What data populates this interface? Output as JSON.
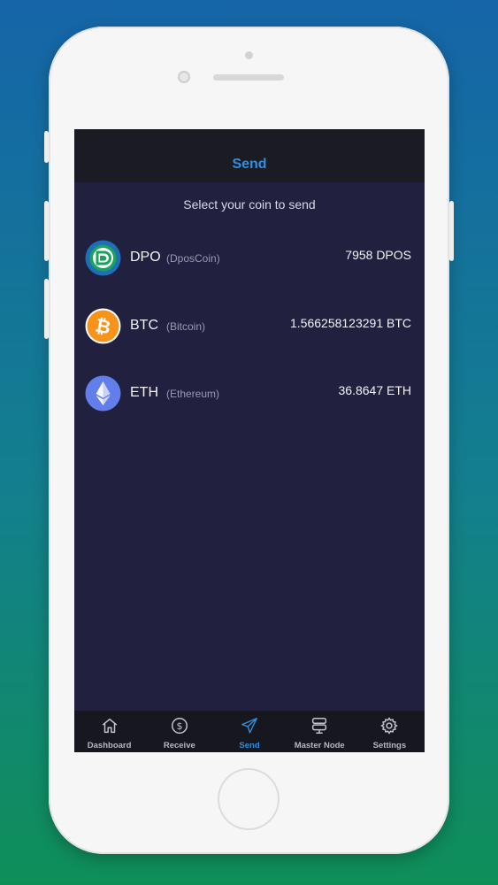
{
  "colors": {
    "accent": "#2f8fe0",
    "screen_background": "#21203f",
    "header_background": "#1b1b24",
    "tabbar_background": "#17171f"
  },
  "header": {
    "title": "Send"
  },
  "subtitle": "Select your coin to send",
  "coins": [
    {
      "symbol": "DPO",
      "name": "(DposCoin)",
      "balance": "7958 DPOS",
      "icon": "dposcoin-logo-icon",
      "color": "#1e6fb8"
    },
    {
      "symbol": "BTC",
      "name": "(Bitcoin)",
      "balance": "1.566258123291 BTC",
      "icon": "bitcoin-icon",
      "color": "#f7931a"
    },
    {
      "symbol": "ETH",
      "name": "(Ethereum)",
      "balance": "36.8647 ETH",
      "icon": "ethereum-icon",
      "color": "#627eea"
    }
  ],
  "tabs": [
    {
      "label": "Dashboard",
      "icon": "home-icon",
      "active": false
    },
    {
      "label": "Receive",
      "icon": "dollar-circle-icon",
      "active": false
    },
    {
      "label": "Send",
      "icon": "paper-plane-icon",
      "active": true
    },
    {
      "label": "Master Node",
      "icon": "server-icon",
      "active": false
    },
    {
      "label": "Settings",
      "icon": "gear-icon",
      "active": false
    }
  ]
}
